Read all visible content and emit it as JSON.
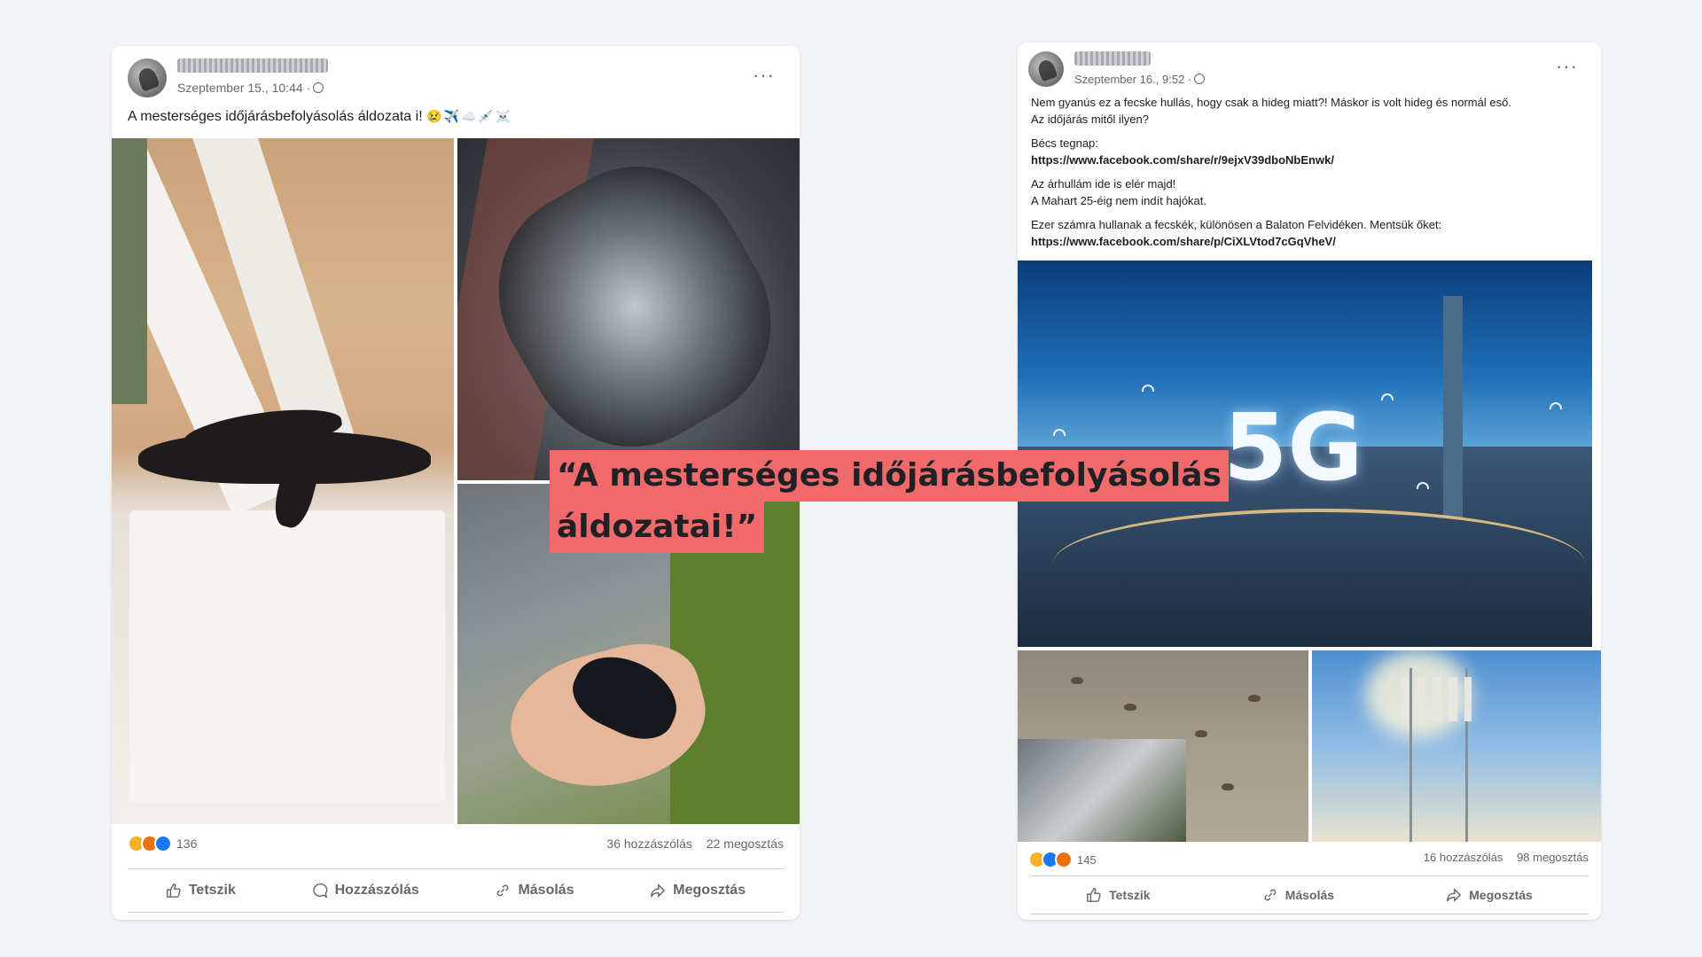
{
  "colors": {
    "background": "#f1f3f6",
    "overlay": "#f0696b",
    "like": "#1877f2"
  },
  "post1": {
    "meta": "Szeptember 15., 10:44 ·",
    "caption": "A mesterséges időjárásbefolyásolás áldozata  i!",
    "caption_emojis": "😢✈️☁️💉☠️",
    "reaction_count": "136",
    "comments": "36 hozzászólás",
    "shares": "22 megosztás",
    "actions": {
      "like": "Tetszik",
      "comment": "Hozzászólás",
      "copy": "Másolás",
      "share": "Megosztás"
    }
  },
  "post2": {
    "meta": "Szeptember 16., 9:52 ·",
    "text1": "Nem gyanús ez a fecske hullás, hogy csak a hideg miatt?! Máskor is volt hideg és normál eső.",
    "text2": "Az időjárás mitől ilyen?",
    "text3": "Bécs tegnap:",
    "link1": "https://www.facebook.com/share/r/9ejxV39dboNbEnwk/",
    "text4": "Az árhullám ide is elér majd!",
    "text5": "A Mahart 25-éig nem indít hajókat.",
    "text6": "Ezer számra hullanak a fecskék, különösen a Balaton Felvidéken. Mentsük őket:",
    "link2": "https://www.facebook.com/share/p/CiXLVtod7cGqVheV/",
    "image_text": "5G",
    "reaction_count": "145",
    "comments": "16 hozzászólás",
    "shares": "98 megosztás",
    "actions": {
      "like": "Tetszik",
      "copy": "Másolás",
      "share": "Megosztás"
    }
  },
  "overlay": {
    "line1": "“A mesterséges időjárásbefolyásolás",
    "line2": "áldozatai!”"
  }
}
